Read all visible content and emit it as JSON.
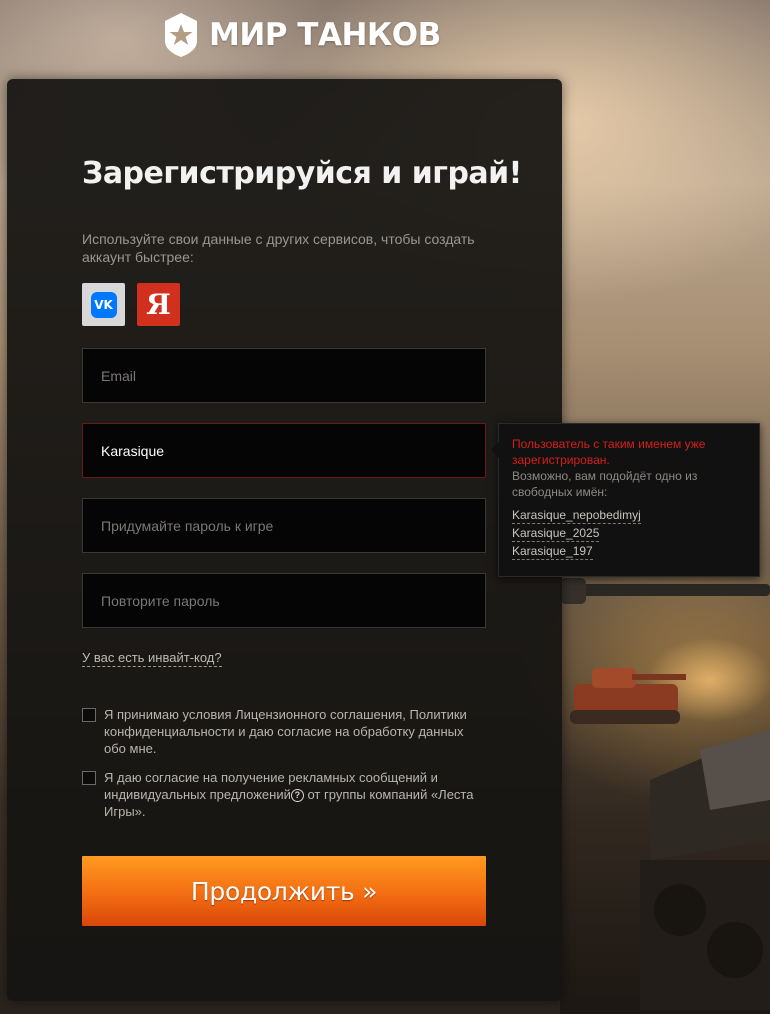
{
  "brand": {
    "logo_text": "МИР ТАНКОВ"
  },
  "form": {
    "title": "Зарегистрируйся и играй!",
    "subtitle": "Используйте свои данные с других сервисов, чтобы создать аккаунт быстрее:",
    "social": [
      {
        "name": "vk",
        "icon": "vk-icon",
        "color": "#0077ff"
      },
      {
        "name": "yandex",
        "icon": "yandex-icon",
        "glyph": "Я",
        "color": "#d0301d"
      }
    ],
    "email": {
      "placeholder": "Email",
      "value": ""
    },
    "nickname": {
      "placeholder": "",
      "value": "Karasique",
      "state": "error"
    },
    "password": {
      "placeholder": "Придумайте пароль к игре",
      "value": ""
    },
    "password_repeat": {
      "placeholder": "Повторите пароль",
      "value": ""
    },
    "invite_link": "У вас есть инвайт-код?",
    "agreements": [
      {
        "checked": false,
        "text": "Я принимаю условия Лицензионного соглашения, Политики конфиденциальности и даю согласие на обработку данных обо мне."
      },
      {
        "checked": false,
        "text_before": "Я даю согласие на получение рекламных сообщений и индивидуальных предложений",
        "text_after": " от группы компаний «Леста Игры»."
      }
    ],
    "submit_label": "Продолжить »"
  },
  "tooltip": {
    "error": "Пользователь с таким именем уже зарегистрирован.",
    "hint": "Возможно, вам подойдёт одно из свободных имён:",
    "suggestions": [
      "Karasique_nepobedimyj",
      "Karasique_2025",
      "Karasique_197"
    ]
  },
  "colors": {
    "accent": "#f36d12",
    "error": "#d4201a",
    "panel": "#161412"
  }
}
